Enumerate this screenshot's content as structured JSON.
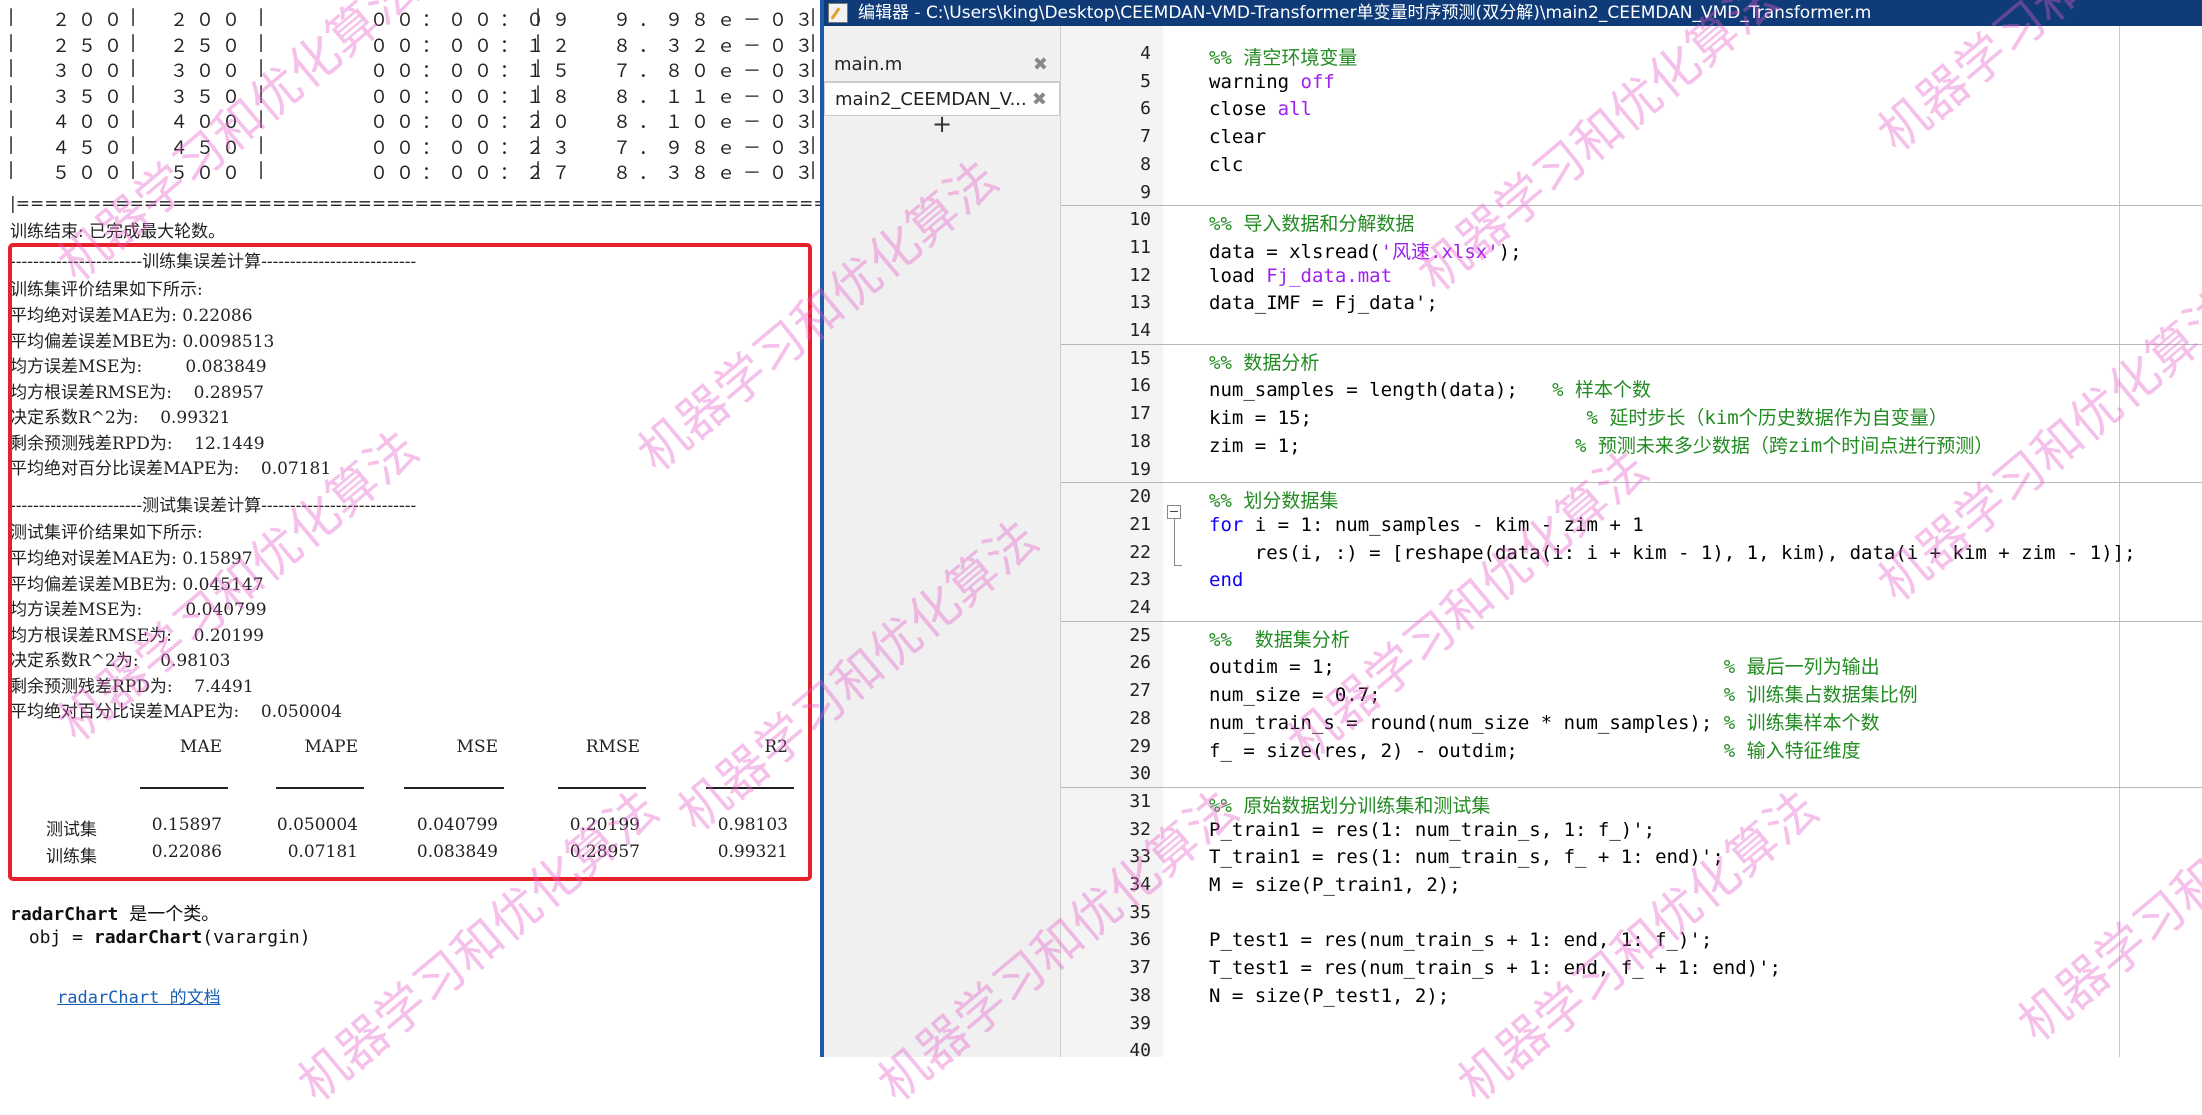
{
  "command_window": {
    "table_rows": [
      [
        "２００",
        "２００",
        "００：００：０９",
        "９．９８ｅ－０３"
      ],
      [
        "２５０",
        "２５０",
        "００：００：１２",
        "８．３２ｅ－０３"
      ],
      [
        "３００",
        "３００",
        "００：００：１５",
        "７．８０ｅ－０３"
      ],
      [
        "３５０",
        "３５０",
        "００：００：１８",
        "８．１１ｅ－０３"
      ],
      [
        "４００",
        "４００",
        "００：００：２０",
        "８．１０ｅ－０３"
      ],
      [
        "４５０",
        "４５０",
        "００：００：２３",
        "７．９８ｅ－０３"
      ],
      [
        "５００",
        "５００",
        "００：００：２７",
        "８．３８ｅ－０３"
      ]
    ],
    "table_bottom": "|===================================================================",
    "training_done": "训练结束: 已完成最大轮数。",
    "train_header": "-----------------------训练集误差计算---------------------------",
    "train_intro": "训练集评价结果如下所示:",
    "train_lines": [
      "平均绝对误差MAE为: 0.22086",
      "平均偏差误差MBE为: 0.0098513",
      "均方误差MSE为:        0.083849",
      "均方根误差RMSE为:    0.28957",
      "决定系数R^2为:    0.99321",
      "剩余预测残差RPD为:    12.1449",
      "平均绝对百分比误差MAPE为:    0.07181"
    ],
    "test_header": "-----------------------测试集误差计算---------------------------",
    "test_intro": "测试集评价结果如下所示:",
    "test_lines": [
      "平均绝对误差MAE为: 0.15897",
      "平均偏差误差MBE为: 0.045147",
      "均方误差MSE为:        0.040799",
      "均方根误差RMSE为:    0.20199",
      "决定系数R^2为:    0.98103",
      "剩余预测残差RPD为:    7.4491",
      "平均绝对百分比误差MAPE为:    0.050004"
    ],
    "result_table": {
      "columns": [
        "MAE",
        "MAPE",
        "MSE",
        "RMSE",
        "R2"
      ],
      "rows": [
        {
          "name": "测试集",
          "values": [
            "0.15897",
            "0.050004",
            "0.040799",
            "0.20199",
            "0.98103"
          ]
        },
        {
          "name": "训练集",
          "values": [
            "0.22086",
            "0.07181",
            "0.083849",
            "0.28957",
            "0.99321"
          ]
        }
      ]
    },
    "help": {
      "class_name": "radarChart",
      "class_desc": " 是一个类。",
      "signature_prefix": " obj = ",
      "signature_func": "radarChart",
      "signature_args": "(varargin)",
      "doc_link": "radarChart 的文档"
    }
  },
  "editor": {
    "title": "编辑器 - C:\\Users\\king\\Desktop\\CEEMDAN-VMD-Transformer单变量时序预测(双分解)\\main2_CEEMDAN_VMD_Transformer.m",
    "tabs": [
      {
        "label": "main.m",
        "close": "✖"
      },
      {
        "label": "main2_CEEMDAN_V...",
        "close": "✖"
      }
    ],
    "add_tab": "+",
    "lines": [
      {
        "n": "4",
        "code": [
          [
            "cm",
            "%% 清空环境变量"
          ]
        ]
      },
      {
        "n": "5",
        "code": [
          [
            "",
            "warning "
          ],
          [
            "str",
            "off"
          ]
        ]
      },
      {
        "n": "6",
        "code": [
          [
            "",
            "close "
          ],
          [
            "str",
            "all"
          ]
        ]
      },
      {
        "n": "7",
        "code": [
          [
            "",
            "clear"
          ]
        ]
      },
      {
        "n": "8",
        "code": [
          [
            "",
            "clc"
          ]
        ]
      },
      {
        "n": "9",
        "code": []
      },
      {
        "n": "10",
        "code": [
          [
            "cm",
            "%% 导入数据和分解数据"
          ]
        ]
      },
      {
        "n": "11",
        "code": [
          [
            "",
            "data = xlsread("
          ],
          [
            "str",
            "'风速.xlsx'"
          ],
          [
            "",
            ");"
          ]
        ]
      },
      {
        "n": "12",
        "code": [
          [
            "",
            "load "
          ],
          [
            "str",
            "Fj_data.mat"
          ]
        ]
      },
      {
        "n": "13",
        "code": [
          [
            "",
            "data_IMF = Fj_data';"
          ]
        ]
      },
      {
        "n": "14",
        "code": []
      },
      {
        "n": "15",
        "code": [
          [
            "cm",
            "%% 数据分析"
          ]
        ]
      },
      {
        "n": "16",
        "code": [
          [
            "",
            "num_samples = length(data);   "
          ],
          [
            "cm",
            "% 样本个数"
          ]
        ]
      },
      {
        "n": "17",
        "code": [
          [
            "",
            "kim = 15;                        "
          ],
          [
            "cm",
            "% 延时步长（kim个历史数据作为自变量）"
          ]
        ]
      },
      {
        "n": "18",
        "code": [
          [
            "",
            "zim = 1;                        "
          ],
          [
            "cm",
            "% 预测未来多少数据（跨zim个时间点进行预测）"
          ]
        ]
      },
      {
        "n": "19",
        "code": []
      },
      {
        "n": "20",
        "code": [
          [
            "cm",
            "%% 划分数据集"
          ]
        ]
      },
      {
        "n": "21",
        "code": [
          [
            "kw",
            "for "
          ],
          [
            "",
            "i = 1: num_samples - kim - zim + 1"
          ]
        ]
      },
      {
        "n": "22",
        "code": [
          [
            "",
            "    res(i, :) = [reshape(data(i: i + kim - 1), 1, kim), data(i + kim + zim - 1)];"
          ]
        ]
      },
      {
        "n": "23",
        "code": [
          [
            "kw",
            "end"
          ]
        ]
      },
      {
        "n": "24",
        "code": []
      },
      {
        "n": "25",
        "code": [
          [
            "cm",
            "%%  数据集分析"
          ]
        ]
      },
      {
        "n": "26",
        "code": [
          [
            "",
            "outdim = 1;                                  "
          ],
          [
            "cm",
            "% 最后一列为输出"
          ]
        ]
      },
      {
        "n": "27",
        "code": [
          [
            "",
            "num_size = 0.7;                              "
          ],
          [
            "cm",
            "% 训练集占数据集比例"
          ]
        ]
      },
      {
        "n": "28",
        "code": [
          [
            "",
            "num_train_s = round(num_size * num_samples); "
          ],
          [
            "cm",
            "% 训练集样本个数"
          ]
        ]
      },
      {
        "n": "29",
        "code": [
          [
            "",
            "f_ = size(res, 2) - outdim;                  "
          ],
          [
            "cm",
            "% 输入特征维度"
          ]
        ]
      },
      {
        "n": "30",
        "code": []
      },
      {
        "n": "31",
        "code": [
          [
            "cm",
            "%% 原始数据划分训练集和测试集"
          ]
        ]
      },
      {
        "n": "32",
        "code": [
          [
            "",
            "P_train1 = res(1: num_train_s, 1: f_)';"
          ]
        ]
      },
      {
        "n": "33",
        "code": [
          [
            "",
            "T_train1 = res(1: num_train_s, f_ + 1: end)';"
          ]
        ]
      },
      {
        "n": "34",
        "code": [
          [
            "",
            "M = size(P_train1, 2);"
          ]
        ]
      },
      {
        "n": "35",
        "code": []
      },
      {
        "n": "36",
        "code": [
          [
            "",
            "P_test1 = res(num_train_s + 1: end, 1: f_)';"
          ]
        ]
      },
      {
        "n": "37",
        "code": [
          [
            "",
            "T_test1 = res(num_train_s + 1: end, f_ + 1: end)';"
          ]
        ]
      },
      {
        "n": "38",
        "code": [
          [
            "",
            "N = size(P_test1, 2);"
          ]
        ]
      },
      {
        "n": "39",
        "code": []
      },
      {
        "n": "40",
        "code": []
      }
    ]
  },
  "watermark": "机器学习和优化算法"
}
